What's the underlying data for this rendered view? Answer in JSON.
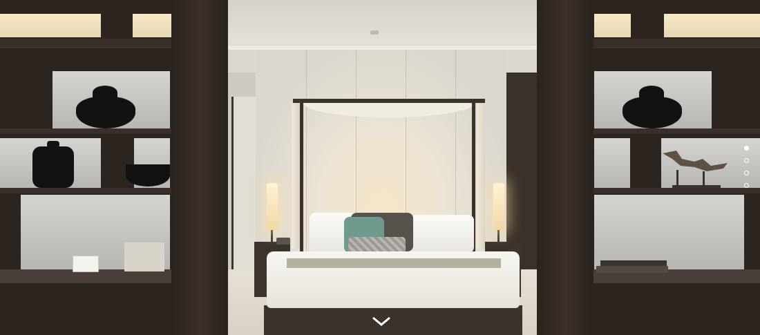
{
  "scene": {
    "subject": "bedroom-suite",
    "colors": {
      "wood": "#2c241e",
      "wall": "#dcd8d0",
      "lamp_glow": "#f3d7a2",
      "accent_teal": "#6f9a8e"
    }
  },
  "carousel": {
    "slide_count": 4,
    "active_index": 0,
    "indicator_icon": "dot-icon"
  },
  "scroll_indicator": {
    "icon": "chevron-down-icon",
    "color": "#ffffff"
  }
}
